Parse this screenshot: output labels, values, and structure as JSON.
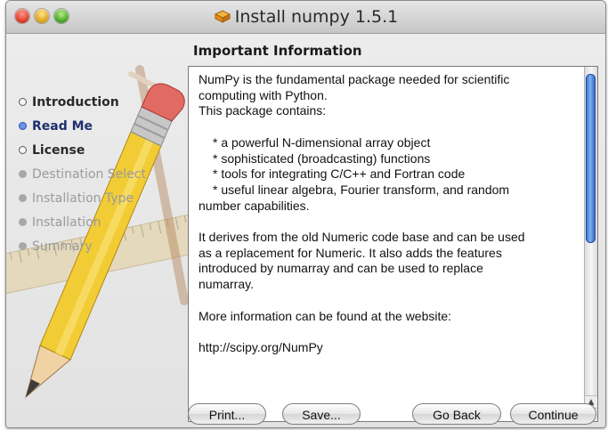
{
  "window": {
    "title": "Install numpy 1.5.1"
  },
  "sidebar": {
    "steps": [
      {
        "label": "Introduction",
        "state": "done"
      },
      {
        "label": "Read Me",
        "state": "active"
      },
      {
        "label": "License",
        "state": "done"
      },
      {
        "label": "Destination Select",
        "state": "pending"
      },
      {
        "label": "Installation Type",
        "state": "pending"
      },
      {
        "label": "Installation",
        "state": "pending"
      },
      {
        "label": "Summary",
        "state": "pending"
      }
    ]
  },
  "main": {
    "heading": "Important Information",
    "lines": [
      "NumPy is the fundamental package needed for scientific",
      "computing with Python.",
      "This package contains:",
      "",
      "* a powerful N-dimensional array object",
      "* sophisticated (broadcasting) functions",
      "* tools for integrating C/C++ and Fortran code",
      "* useful linear algebra, Fourier transform, and random",
      "number capabilities.",
      "",
      "It derives from the old Numeric code base and can be used",
      "as a replacement for Numeric. It also adds the features",
      "introduced by numarray and can be used to replace",
      "numarray.",
      "",
      "More information can be found at the website:",
      "",
      "http://scipy.org/NumPy"
    ]
  },
  "buttons": {
    "print": "Print...",
    "save": "Save...",
    "go_back": "Go Back",
    "continue": "Continue"
  },
  "colors": {
    "active_step": "#1f2f6e",
    "scroll_thumb": "#3a78d8"
  }
}
